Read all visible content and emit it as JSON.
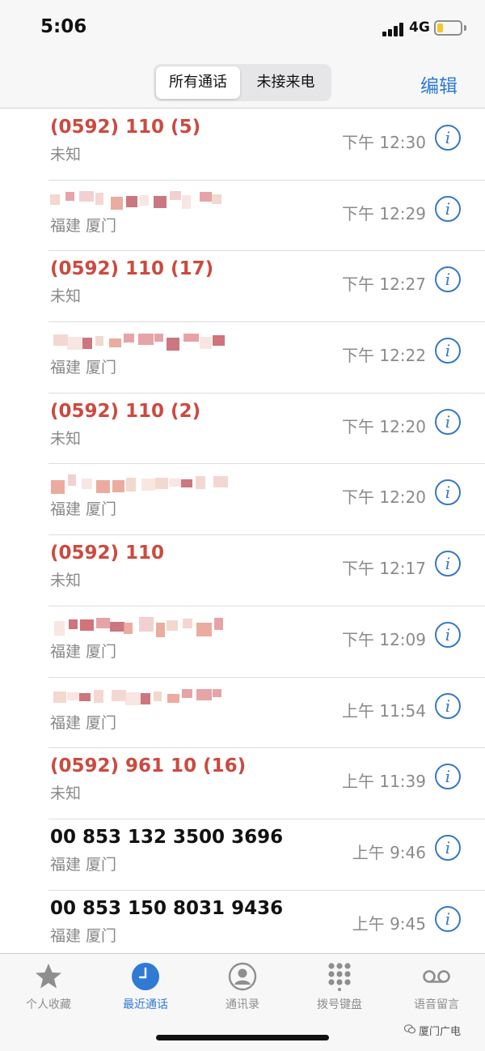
{
  "status_bar": {
    "time": "5:06",
    "network": "4G"
  },
  "nav": {
    "segments": [
      "所有通话",
      "未接来电"
    ],
    "edit_label": "编辑"
  },
  "calls": [
    {
      "name": "(0592) 110 (5)",
      "missed": true,
      "sub": "未知",
      "time": "下午 12:30",
      "redacted": false
    },
    {
      "name": "",
      "missed": false,
      "sub": "福建 厦门",
      "time": "下午 12:29",
      "redacted": true
    },
    {
      "name": "(0592) 110 (17)",
      "missed": true,
      "sub": "未知",
      "time": "下午 12:27",
      "redacted": false
    },
    {
      "name": "",
      "missed": false,
      "sub": "福建 厦门",
      "time": "下午 12:22",
      "redacted": true
    },
    {
      "name": "(0592) 110 (2)",
      "missed": true,
      "sub": "未知",
      "time": "下午 12:20",
      "redacted": false
    },
    {
      "name": "",
      "missed": false,
      "sub": "福建 厦门",
      "time": "下午 12:20",
      "redacted": true
    },
    {
      "name": "(0592) 110",
      "missed": true,
      "sub": "未知",
      "time": "下午 12:17",
      "redacted": false
    },
    {
      "name": "",
      "missed": false,
      "sub": "福建 厦门",
      "time": "下午 12:09",
      "redacted": true
    },
    {
      "name": "",
      "missed": false,
      "sub": "福建 厦门",
      "time": "上午 11:54",
      "redacted": true
    },
    {
      "name": "(0592) 961 10 (16)",
      "missed": true,
      "sub": "未知",
      "time": "上午 11:39",
      "redacted": false
    },
    {
      "name": "00 853 132 3500 3696",
      "missed": false,
      "sub": "福建 厦门",
      "time": "上午 9:46",
      "redacted": false
    },
    {
      "name": "00 853 150 8031 9436",
      "missed": false,
      "sub": "福建 厦门",
      "time": "上午 9:45",
      "redacted": false
    }
  ],
  "tabs": [
    {
      "label": "个人收藏",
      "icon": "star-icon",
      "active": false
    },
    {
      "label": "最近通话",
      "icon": "clock-icon",
      "active": true
    },
    {
      "label": "通讯录",
      "icon": "contact-icon",
      "active": false
    },
    {
      "label": "拨号键盘",
      "icon": "keypad-icon",
      "active": false
    },
    {
      "label": "语音留言",
      "icon": "voicemail-icon",
      "active": false
    }
  ],
  "watermark": "厦门广电",
  "colors": {
    "accent": "#2f7ad3",
    "missed": "#cc4a3f",
    "battery": "#f3c62c"
  }
}
